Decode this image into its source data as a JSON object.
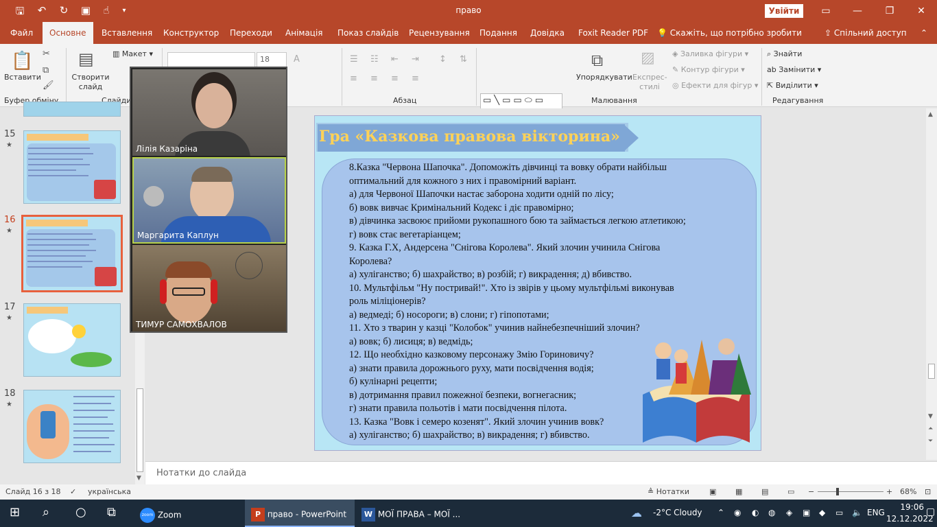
{
  "titlebar": {
    "title": "право",
    "signin": "Увійти",
    "quick_access": [
      "save-icon",
      "undo-icon",
      "redo-icon",
      "present-icon",
      "touch-icon",
      "more-icon"
    ]
  },
  "tabs": [
    "Файл",
    "Основне",
    "Вставлення",
    "Конструктор",
    "Переходи",
    "Анімація",
    "Показ слайдів",
    "Рецензування",
    "Подання",
    "Довідка",
    "Foxit Reader PDF",
    "Скажіть, що потрібно зробити",
    "Спільний доступ"
  ],
  "ribbon": {
    "clipboard": {
      "paste": "Вставити",
      "group": "Буфер обміну"
    },
    "slides": {
      "new_slide": "Створити слайд",
      "layout": "Макет",
      "group": "Слайди"
    },
    "font": {
      "size": "18"
    },
    "paragraph": {
      "group": "Абзац"
    },
    "drawing": {
      "arrange": "Упорядкувати",
      "quick_styles": "Експрес-стилі",
      "fill": "Заливка фігури",
      "outline": "Контур фігури",
      "effects": "Ефекти для фігур",
      "group": "Малювання"
    },
    "editing": {
      "find": "Знайти",
      "replace": "Замінити",
      "select": "Виділити",
      "group": "Редагування"
    }
  },
  "thumbnails": [
    {
      "num": "15",
      "selected": false
    },
    {
      "num": "16",
      "selected": true
    },
    {
      "num": "17",
      "selected": false
    },
    {
      "num": "18",
      "selected": false
    }
  ],
  "slide": {
    "title": "Гра «Казкова правова вікторина»",
    "lines": [
      "8.Казка \"Червона Шапочка\". Допоможіть дівчинці та вовку обрати найбільш",
      "оптимальний для кожного з них і правомірний варіант.",
      "а) для Червоної Шапочки настає заборона ходити одній по лісу;",
      "б) вовк вивчає Кримінальний Кодекс і діє правомірно;",
      "в) дівчинка засвоює прийоми рукопашного бою та займається легкою атлетикою;",
      "г) вовк стає вегетаріанцем;",
      "9. Казка Г.Х, Андерсена \"Снігова Королева\". Який злочин учинила Снігова",
      "Королева?",
      "а) хуліганство; б) шахрайство; в) розбій; г) викрадення; д) вбивство.",
      "10. Мультфільм \"Ну постривай!\". Хто із звірів у цьому мультфільмі виконував",
      "роль міліціонерів?",
      "а) ведмеді; б) носороги; в) слони; г) гіпопотами;",
      "11. Хто з тварин у казці \"Колобок\" учинив найнебезпечніший злочин?",
      "а) вовк; б) лисиця; в) ведмідь;",
      "12. Що необхідно казковому персонажу Змію Гориновичу?",
      "а) знати правила дорожнього руху, мати посвідчення водія;",
      "б) кулінарні рецепти;",
      "в) дотримання правил пожежної безпеки, вогнегасник;",
      "г) знати правила польотів і мати посвідчення пілота.",
      "13. Казка \"Вовк і семеро козенят\". Який злочин учинив вовк?",
      "а) хуліганство; б) шахрайство; в) викрадення; г) вбивство."
    ]
  },
  "notes_placeholder": "Нотатки до слайда",
  "status": {
    "slide": "Слайд 16 з 18",
    "language": "українська",
    "notes": "Нотатки",
    "zoom": "68%"
  },
  "zoom_participants": [
    "Лілія Казаріна",
    "Маргарита Каплун",
    "ТИМУР  САМОХВАЛОВ"
  ],
  "taskbar": {
    "apps": [
      "Zoom",
      "право - PowerPoint",
      "МОЇ ПРАВА – МОЇ ..."
    ],
    "weather": "-2°C  Cloudy",
    "lang": "ENG",
    "time": "19:06",
    "date": "12.12.2022"
  }
}
